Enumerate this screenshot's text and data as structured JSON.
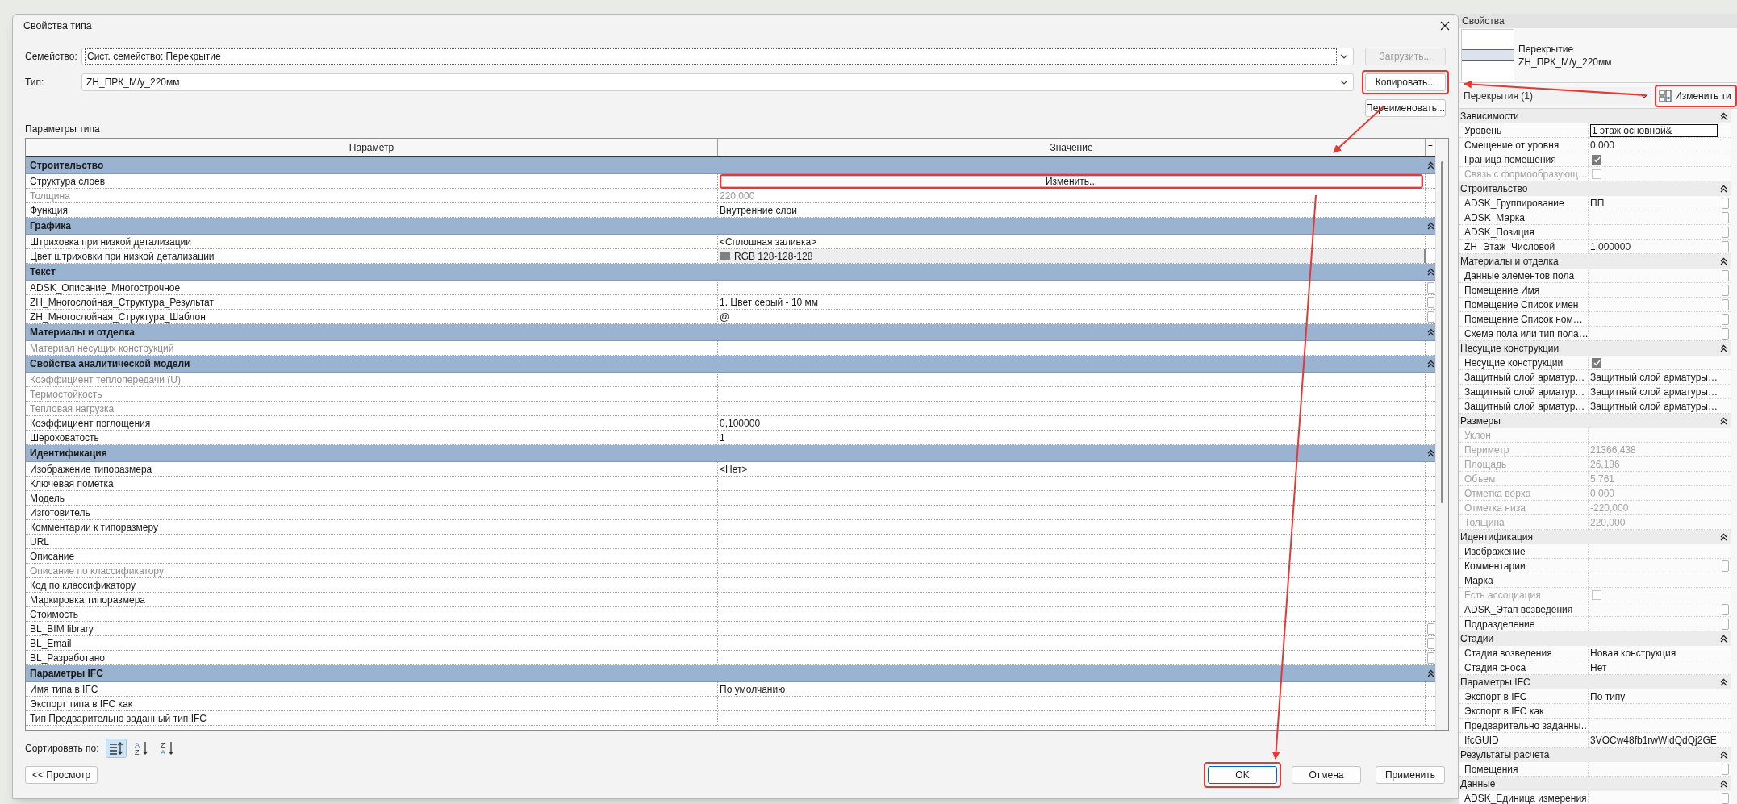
{
  "window": {
    "title": "Свойства типа"
  },
  "family": {
    "label": "Семейство:",
    "value": "Сист. семейство: Перекрытие"
  },
  "type": {
    "label": "Тип:",
    "value": "ZH_ПРК_М/у_220мм"
  },
  "side_buttons": [
    {
      "label": "Загрузить...",
      "disabled": true,
      "highlighted": false
    },
    {
      "label": "Копировать...",
      "disabled": false,
      "highlighted": true
    },
    {
      "label": "Переименовать...",
      "disabled": false,
      "highlighted": false
    }
  ],
  "type_parameters": {
    "title": "Параметры типа",
    "columns": [
      "Параметр",
      "Значение",
      "="
    ],
    "groups": [
      {
        "name": "Строительство",
        "rows": [
          {
            "name": "Структура слоев",
            "kind": "button",
            "value": "Изменить...",
            "highlighted": true,
            "disabled": false,
            "associate": false
          },
          {
            "name": "Толщина",
            "kind": "text",
            "value": "220,000",
            "disabled": true,
            "associate": false
          },
          {
            "name": "Функция",
            "kind": "text",
            "value": "Внутренние слои",
            "disabled": false,
            "associate": false
          }
        ]
      },
      {
        "name": "Графика",
        "rows": [
          {
            "name": "Штриховка при низкой детализации",
            "kind": "text",
            "value": "<Сплошная заливка>",
            "disabled": false,
            "associate": false
          },
          {
            "name": "Цвет штриховки при низкой детализации",
            "kind": "color",
            "value": "RGB 128-128-128",
            "color": "#808080",
            "disabled": false,
            "associate": false
          }
        ]
      },
      {
        "name": "Текст",
        "rows": [
          {
            "name": "ADSK_Описание_Многострочное",
            "kind": "text",
            "disabled": false,
            "associate": true
          },
          {
            "name": "ZH_Многослойная_Структура_Результат",
            "kind": "text",
            "value": "1. Цвет серый - 10 мм",
            "disabled": false,
            "associate": true
          },
          {
            "name": "ZH_Многослойная_Структура_Шаблон",
            "kind": "text",
            "value": "@",
            "disabled": false,
            "associate": true
          }
        ]
      },
      {
        "name": "Материалы и отделка",
        "rows": [
          {
            "name": "Материал несущих конструкций",
            "kind": "text",
            "disabled": true,
            "associate": false
          }
        ]
      },
      {
        "name": "Свойства аналитической модели",
        "rows": [
          {
            "name": "Коэффициент теплопередачи (U)",
            "kind": "text",
            "disabled": true,
            "associate": false
          },
          {
            "name": "Термостойкость",
            "kind": "text",
            "disabled": true,
            "associate": false
          },
          {
            "name": "Тепловая нагрузка",
            "kind": "text",
            "disabled": true,
            "associate": false
          },
          {
            "name": "Коэффициент поглощения",
            "kind": "text",
            "value": "0,100000",
            "disabled": false,
            "associate": false
          },
          {
            "name": "Шероховатость",
            "kind": "text",
            "value": "1",
            "disabled": false,
            "associate": false
          }
        ]
      },
      {
        "name": "Идентификация",
        "rows": [
          {
            "name": "Изображение типоразмера",
            "kind": "text",
            "value": "<Нет>",
            "disabled": false,
            "associate": false
          },
          {
            "name": "Ключевая пометка",
            "kind": "text",
            "disabled": false,
            "associate": false
          },
          {
            "name": "Модель",
            "kind": "text",
            "disabled": false,
            "associate": false
          },
          {
            "name": "Изготовитель",
            "kind": "text",
            "disabled": false,
            "associate": false
          },
          {
            "name": "Комментарии к типоразмеру",
            "kind": "text",
            "disabled": false,
            "associate": false
          },
          {
            "name": "URL",
            "kind": "text",
            "disabled": false,
            "associate": false
          },
          {
            "name": "Описание",
            "kind": "text",
            "disabled": false,
            "associate": false
          },
          {
            "name": "Описание по классификатору",
            "kind": "text",
            "disabled": true,
            "associate": false
          },
          {
            "name": "Код по классификатору",
            "kind": "text",
            "disabled": false,
            "associate": false
          },
          {
            "name": "Маркировка типоразмера",
            "kind": "text",
            "disabled": false,
            "associate": false
          },
          {
            "name": "Стоимость",
            "kind": "text",
            "disabled": false,
            "associate": false
          },
          {
            "name": "BL_BIM library",
            "kind": "text",
            "disabled": false,
            "associate": true
          },
          {
            "name": "BL_Email",
            "kind": "text",
            "disabled": false,
            "associate": true
          },
          {
            "name": "BL_Разработано",
            "kind": "text",
            "disabled": false,
            "associate": true
          }
        ]
      },
      {
        "name": "Параметры IFC",
        "rows": [
          {
            "name": "Имя типа в IFC",
            "kind": "text",
            "value": "По умолчанию",
            "disabled": false,
            "associate": false
          },
          {
            "name": "Экспорт типа в IFC как",
            "kind": "text",
            "disabled": false,
            "associate": false
          },
          {
            "name": "Тип Предварительно заданный тип IFC",
            "kind": "text",
            "disabled": false,
            "associate": false
          }
        ]
      }
    ]
  },
  "sort": {
    "label": "Сортировать по:",
    "options": [
      {
        "kind": "grouped",
        "selected": true
      },
      {
        "kind": "ascending",
        "top": "A",
        "bottom": "Z",
        "selected": false
      },
      {
        "kind": "descending",
        "top": "Z",
        "bottom": "A",
        "selected": false
      }
    ]
  },
  "preview_button": "<< Просмотр",
  "buttons": [
    {
      "label": "OK",
      "default": true,
      "highlighted": true
    },
    {
      "label": "Отмена",
      "default": false,
      "highlighted": false
    },
    {
      "label": "Применить",
      "default": false,
      "highlighted": false
    }
  ],
  "properties_panel": {
    "title": "Свойства",
    "category": "Перекрытие",
    "type_name": "ZH_ПРК_М/у_220мм",
    "selector": "Перекрытия (1)",
    "edit_type_button": {
      "label": "Изменить ти",
      "highlighted": true
    },
    "groups": [
      {
        "name": "Зависимости",
        "rows": [
          {
            "name": "Уровень",
            "kind": "field",
            "value": "1 этаж основной&",
            "disabled": false,
            "associate": false
          },
          {
            "name": "Смещение от уровня",
            "kind": "text",
            "value": "0,000",
            "disabled": false,
            "associate": false
          },
          {
            "name": "Граница помещения",
            "kind": "checkbox",
            "checked": true,
            "disabled": false,
            "associate": false
          },
          {
            "name": "Связь с формообразующ…",
            "kind": "checkbox",
            "checked": false,
            "disabled": true,
            "associate": false
          }
        ]
      },
      {
        "name": "Строительство",
        "rows": [
          {
            "name": "ADSK_Группирование",
            "kind": "text",
            "value": "ПП",
            "disabled": false,
            "associate": true
          },
          {
            "name": "ADSK_Марка",
            "kind": "text",
            "disabled": false,
            "associate": true
          },
          {
            "name": "ADSK_Позиция",
            "kind": "text",
            "disabled": false,
            "associate": true
          },
          {
            "name": "ZH_Этаж_Числовой",
            "kind": "text",
            "value": "1,000000",
            "disabled": false,
            "associate": true
          }
        ]
      },
      {
        "name": "Материалы и отделка",
        "rows": [
          {
            "name": "Данные элементов пола",
            "kind": "text",
            "disabled": false,
            "associate": true
          },
          {
            "name": "Помещение Имя",
            "kind": "text",
            "disabled": false,
            "associate": true
          },
          {
            "name": "Помещение Список имен",
            "kind": "text",
            "disabled": false,
            "associate": true
          },
          {
            "name": "Помещение Список ном…",
            "kind": "text",
            "disabled": false,
            "associate": true
          },
          {
            "name": "Схема пола или тип пола…",
            "kind": "text",
            "disabled": false,
            "associate": true
          }
        ]
      },
      {
        "name": "Несущие конструкции",
        "rows": [
          {
            "name": "Несущие конструкции",
            "kind": "checkbox",
            "checked": true,
            "disabled": false,
            "associate": false
          },
          {
            "name": "Защитный слой арматур…",
            "kind": "text",
            "value": "Защитный слой арматуры…",
            "disabled": false,
            "associate": false
          },
          {
            "name": "Защитный слой арматур…",
            "kind": "text",
            "value": "Защитный слой арматуры…",
            "disabled": false,
            "associate": false
          },
          {
            "name": "Защитный слой арматур…",
            "kind": "text",
            "value": "Защитный слой арматуры…",
            "disabled": false,
            "associate": false
          }
        ]
      },
      {
        "name": "Размеры",
        "rows": [
          {
            "name": "Уклон",
            "kind": "text",
            "disabled": true,
            "associate": false
          },
          {
            "name": "Периметр",
            "kind": "text",
            "value": "21366,438",
            "disabled": true,
            "associate": false
          },
          {
            "name": "Площадь",
            "kind": "text",
            "value": "26,186",
            "disabled": true,
            "associate": false
          },
          {
            "name": "Объем",
            "kind": "text",
            "value": "5,761",
            "disabled": true,
            "associate": false
          },
          {
            "name": "Отметка верха",
            "kind": "text",
            "value": "0,000",
            "disabled": true,
            "associate": false
          },
          {
            "name": "Отметка низа",
            "kind": "text",
            "value": "-220,000",
            "disabled": true,
            "associate": false
          },
          {
            "name": "Толщина",
            "kind": "text",
            "value": "220,000",
            "disabled": true,
            "associate": false
          }
        ]
      },
      {
        "name": "Идентификация",
        "rows": [
          {
            "name": "Изображение",
            "kind": "text",
            "disabled": false,
            "associate": false
          },
          {
            "name": "Комментарии",
            "kind": "text",
            "disabled": false,
            "associate": true
          },
          {
            "name": "Марка",
            "kind": "text",
            "disabled": false,
            "associate": false
          },
          {
            "name": "Есть ассоциация",
            "kind": "checkbox",
            "checked": false,
            "disabled": true,
            "associate": false
          },
          {
            "name": "ADSK_Этап возведения",
            "kind": "text",
            "disabled": false,
            "associate": true
          },
          {
            "name": "Подразделение",
            "kind": "text",
            "disabled": false,
            "associate": true
          }
        ]
      },
      {
        "name": "Стадии",
        "rows": [
          {
            "name": "Стадия возведения",
            "kind": "text",
            "value": "Новая конструкция",
            "disabled": false,
            "associate": false
          },
          {
            "name": "Стадия сноса",
            "kind": "text",
            "value": "Нет",
            "disabled": false,
            "associate": false
          }
        ]
      },
      {
        "name": "Параметры IFC",
        "rows": [
          {
            "name": "Экспорт в IFC",
            "kind": "text",
            "value": "По типу",
            "disabled": false,
            "associate": false
          },
          {
            "name": "Экспорт в IFC как",
            "kind": "text",
            "disabled": false,
            "associate": false
          },
          {
            "name": "Предварительно заданны…",
            "kind": "text",
            "disabled": false,
            "associate": false
          },
          {
            "name": "IfcGUID",
            "kind": "text",
            "value": "3VOCw48fb1rwWidQdQj2GE",
            "disabled": false,
            "associate": false
          }
        ]
      },
      {
        "name": "Результаты расчета",
        "rows": [
          {
            "name": "Помещения",
            "kind": "text",
            "disabled": false,
            "associate": true
          }
        ]
      },
      {
        "name": "Данные",
        "rows": [
          {
            "name": "ADSK_Единица измерения",
            "kind": "text",
            "disabled": false,
            "associate": true
          }
        ]
      }
    ]
  }
}
